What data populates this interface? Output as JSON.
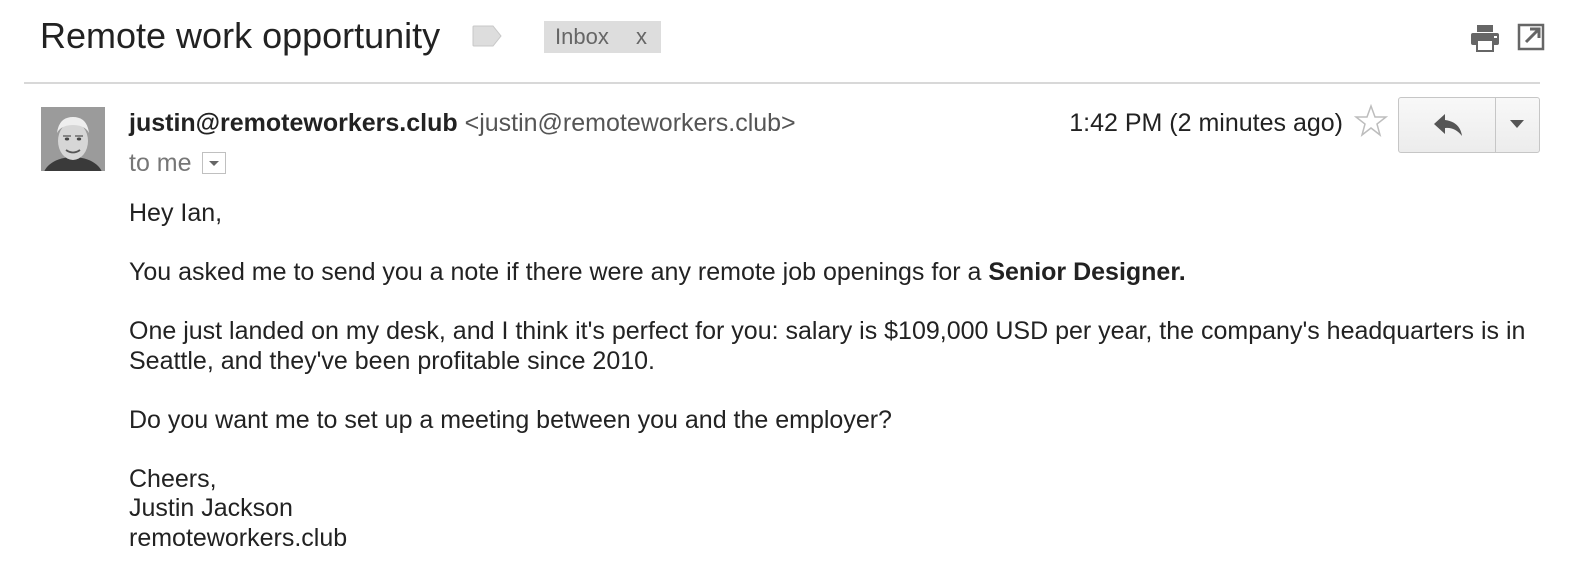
{
  "header": {
    "subject": "Remote work opportunity",
    "label_chip": {
      "text": "Inbox",
      "remove": "x"
    },
    "icons": [
      "label-tag-icon",
      "print-icon",
      "new-window-icon"
    ]
  },
  "message": {
    "sender_name": "justin@remoteworkers.club",
    "sender_email": "<justin@remoteworkers.club>",
    "recipient": "to me",
    "timestamp": "1:42 PM (2 minutes ago)",
    "actions": {
      "reply_icon": "reply-icon",
      "more_icon": "dropdown-arrow-icon",
      "star_icon": "star-icon"
    },
    "body": {
      "greeting": "Hey Ian,",
      "para1_prefix": "You asked me to send you a note if there were any remote job openings for a ",
      "para1_bold": "Senior Designer.",
      "para2": "One just landed on my desk, and I think it's perfect for you: salary is $109,000 USD per year, the company's headquarters is in Seattle, and they've been profitable since 2010.",
      "para3": "Do you want me to set up a meeting between you and the employer?",
      "signoff": "Cheers,",
      "signature_name": "Justin Jackson",
      "signature_site": "remoteworkers.club"
    }
  },
  "colors": {
    "text": "#222222",
    "muted": "#777777",
    "chip_bg": "#dddddd",
    "divider": "#d8d8d8"
  }
}
